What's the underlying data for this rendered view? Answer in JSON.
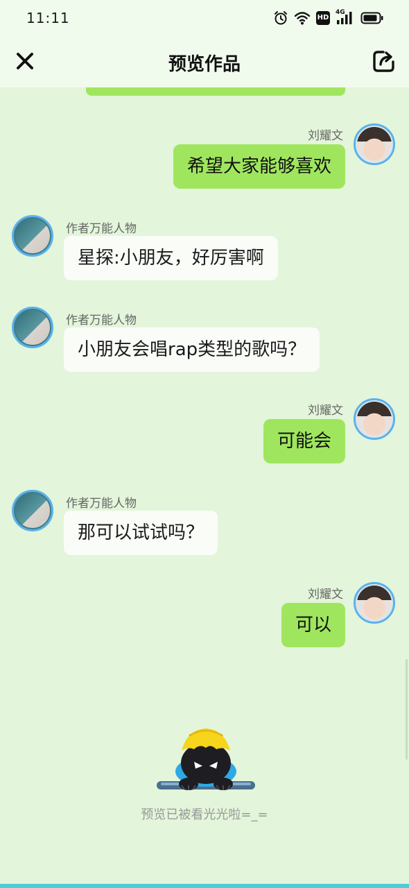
{
  "status_bar": {
    "time": "11:11",
    "icons": [
      "alarm-icon",
      "wifi-icon",
      "hd-icon",
      "4g-signal-icon",
      "battery-icon"
    ],
    "hd_label": "HD",
    "network_label": "4G"
  },
  "header": {
    "title": "预览作品",
    "close_icon": "close-icon",
    "share_icon": "share-icon"
  },
  "messages": [
    {
      "side": "right",
      "name": "刘耀文",
      "text": "希望大家能够喜欢"
    },
    {
      "side": "left",
      "name": "作者万能人物",
      "text": "星探:小朋友，好厉害啊"
    },
    {
      "side": "left",
      "name": "作者万能人物",
      "text": "小朋友会唱rap类型的歌吗？"
    },
    {
      "side": "right",
      "name": "刘耀文",
      "text": "可能会"
    },
    {
      "side": "left",
      "name": "作者万能人物",
      "text": "那可以试试吗？"
    },
    {
      "side": "right",
      "name": "刘耀文",
      "text": "可以"
    }
  ],
  "end_text": "预览已被看光光啦=_=",
  "colors": {
    "background": "#e3f5da",
    "header": "#f1fbed",
    "right_bubble": "#9fe65e",
    "left_bubble": "#fafcf8",
    "avatar_ring": "#5ab2ec",
    "bottom_bar": "#4ecdd6"
  }
}
